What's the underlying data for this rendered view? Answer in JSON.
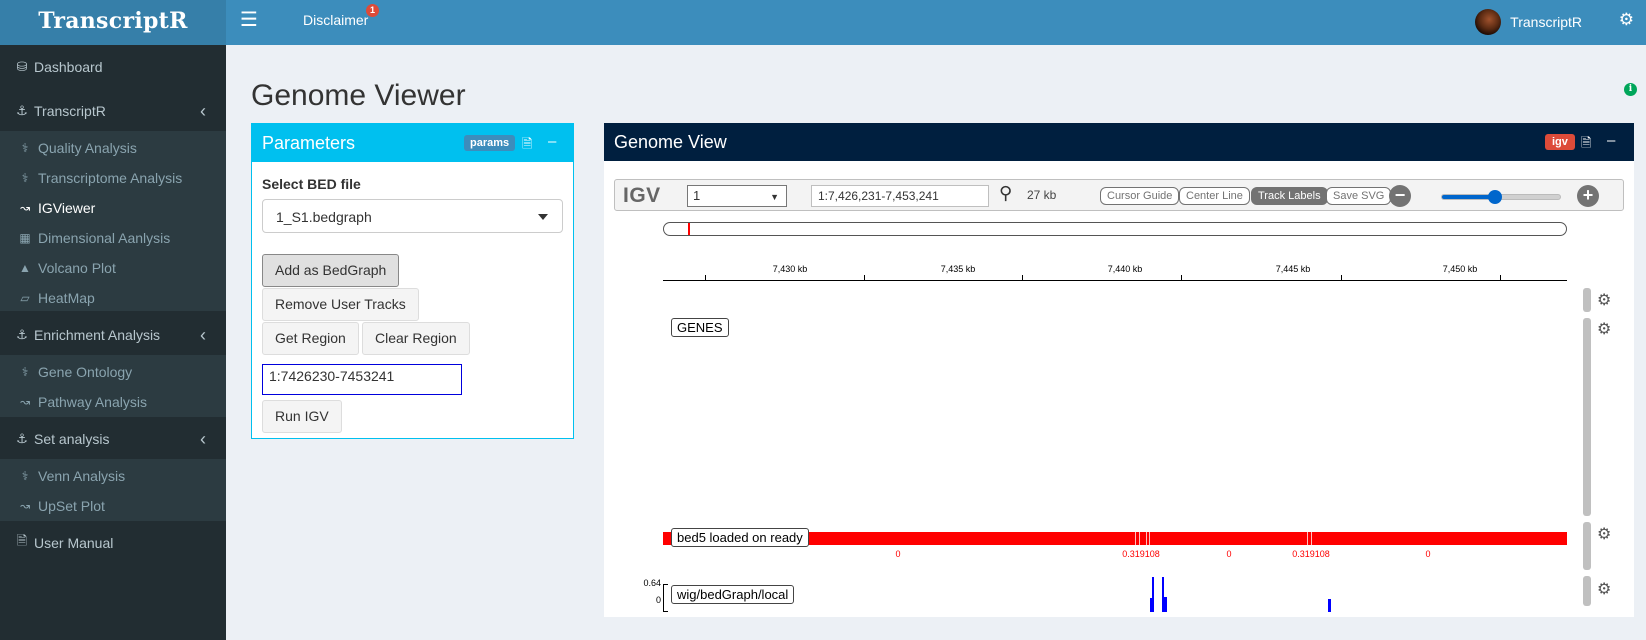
{
  "app": {
    "logo": "TranscriptR"
  },
  "header": {
    "disclaimer": "Disclaimer",
    "disclaimer_badge": "1",
    "user_name": "TranscriptR"
  },
  "sidebar": {
    "dashboard": "Dashboard",
    "transcriptr": "TranscriptR",
    "transcriptr_items": [
      "Quality Analysis",
      "Transcriptome Analysis",
      "IGViewer",
      "Dimensional Aanlysis",
      "Volcano Plot",
      "HeatMap"
    ],
    "active_item": "IGViewer",
    "enrichment": "Enrichment Analysis",
    "enrichment_items": [
      "Gene Ontology",
      "Pathway Analysis"
    ],
    "set_analysis": "Set analysis",
    "set_items": [
      "Venn Analysis",
      "UpSet Plot"
    ],
    "user_manual": "User Manual"
  },
  "page": {
    "title": "Genome Viewer"
  },
  "parameters": {
    "title": "Parameters",
    "badge": "params",
    "select_label": "Select BED file",
    "selected_file": "1_S1.bedgraph",
    "add_button": "Add as BedGraph",
    "remove_button": "Remove User Tracks",
    "get_region_button": "Get Region",
    "clear_region_button": "Clear Region",
    "region_value": "1:7426230-7453241",
    "run_button": "Run IGV"
  },
  "genome_view": {
    "title": "Genome View",
    "badge": "igv",
    "igv_logo": "IGV",
    "chromosome": "1",
    "locus": "1:7,426,231-7,453,241",
    "window_size": "27 kb",
    "buttons": {
      "cursor_guide": "Cursor Guide",
      "center_line": "Center Line",
      "track_labels": "Track Labels",
      "save_svg": "Save SVG"
    },
    "zoom_level": 0.45,
    "ruler": [
      "7,430 kb",
      "7,435 kb",
      "7,440 kb",
      "7,445 kb",
      "7,450 kb"
    ],
    "tracks": {
      "genes": "GENES",
      "bed": "bed5 loaded on ready",
      "bed_values": [
        "0",
        "0.319108",
        "0",
        "0.319108",
        "0"
      ],
      "wig": "wig/bedGraph/local",
      "wig_max": "0.64",
      "wig_min": "0"
    }
  },
  "colors": {
    "header": "#3c8dbc",
    "logo_bg": "#367fa9",
    "sidebar": "#222d32",
    "params_box": "#00c0ef",
    "genome_box": "#001f3f",
    "bed_track": "#ff0000",
    "wig_track": "#0000ff"
  }
}
